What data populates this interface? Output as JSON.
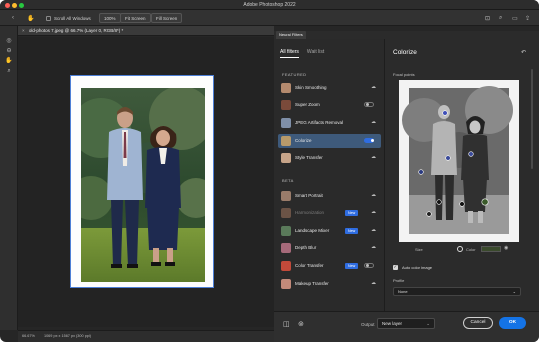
{
  "window": {
    "title": "Adobe Photoshop 2022"
  },
  "options_bar": {
    "scroll_all_windows": "Scroll All Windows",
    "zoom_value": "100%",
    "fit_screen": "Fit Screen",
    "fill_screen": "Fill Screen"
  },
  "document": {
    "tab_title": "old-photos 7.jpeg @ 66.7% (Layer 0, RGB/8*) *",
    "zoom": "66.67%",
    "dimensions": "1069 px x 1567 px (300 ppi)"
  },
  "panel": {
    "header": "Neural Filters"
  },
  "filters": {
    "tabs": [
      "All filters",
      "Wait list"
    ],
    "featured_title": "FEATURED",
    "beta_title": "BETA",
    "featured": [
      {
        "label": "Skin Smoothing",
        "toggle": "none",
        "cloud": true,
        "thumb": "#b48a6e"
      },
      {
        "label": "Super Zoom",
        "toggle": "off",
        "cloud": false,
        "thumb": "#7a4a3a"
      },
      {
        "label": "JPEG Artifacts Removal",
        "toggle": "none",
        "cloud": true,
        "thumb": "#7f8fa8"
      },
      {
        "label": "Colorize",
        "toggle": "on",
        "cloud": false,
        "thumb": "#b89a6a",
        "selected": true
      },
      {
        "label": "Style Transfer",
        "toggle": "none",
        "cloud": true,
        "thumb": "#c7a489"
      }
    ],
    "beta": [
      {
        "label": "Smart Portrait",
        "toggle": "none",
        "cloud": true,
        "thumb": "#9a7c6a"
      },
      {
        "label": "Harmonization",
        "toggle": "none",
        "cloud": true,
        "thumb": "#6b5346",
        "badge": "New",
        "dim": true
      },
      {
        "label": "Landscape Mixer",
        "toggle": "none",
        "cloud": true,
        "thumb": "#5a7a5a",
        "badge": "New"
      },
      {
        "label": "Depth Blur",
        "toggle": "none",
        "cloud": true,
        "thumb": "#a66a7a"
      },
      {
        "label": "Color Transfer",
        "toggle": "off",
        "cloud": false,
        "thumb": "#c24a3a",
        "badge": "New"
      },
      {
        "label": "Makeup Transfer",
        "toggle": "none",
        "cloud": true,
        "thumb": "#c38a7a"
      }
    ]
  },
  "colorize": {
    "title": "Colorize",
    "focal_points": "Focal points",
    "size_label": "Size",
    "color_label": "Color",
    "color_swatch": "#3a4a2c",
    "auto_color": "Auto color image",
    "profile_label": "Profile",
    "profile_value": "None"
  },
  "bottom": {
    "output_label": "Output",
    "output_value": "New layer",
    "cancel": "Cancel",
    "ok": "OK"
  },
  "colors": {
    "accent": "#1473e6",
    "selected_row": "#3e5a7b",
    "badge": "#2f6de1"
  }
}
